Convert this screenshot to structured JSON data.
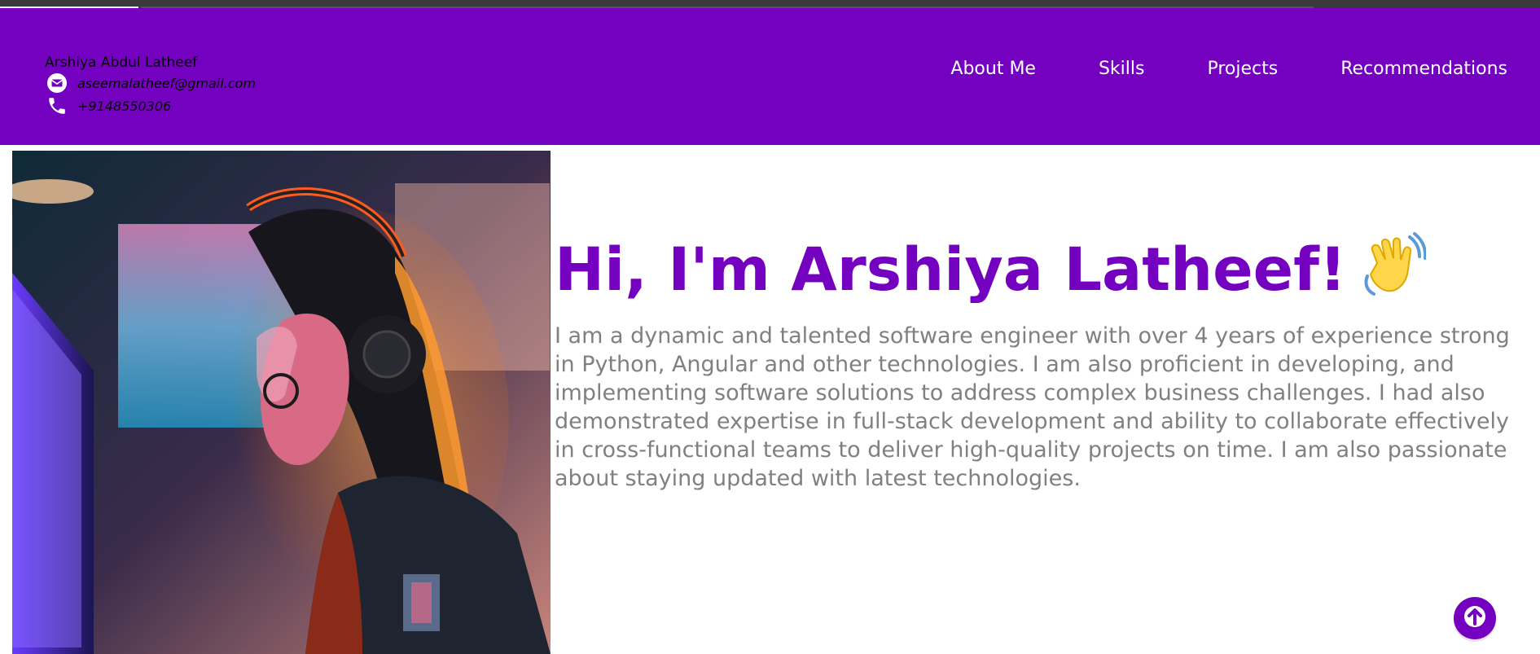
{
  "header": {
    "name": "Arshiya Abdul Latheef",
    "email": "aseemalatheef@gmail.com",
    "phone": "+9148550306",
    "icons": {
      "email": "envelope-icon",
      "phone": "phone-icon"
    }
  },
  "nav": {
    "items": [
      {
        "label": "About Me"
      },
      {
        "label": "Skills"
      },
      {
        "label": "Projects"
      },
      {
        "label": "Recommendations"
      }
    ]
  },
  "hero": {
    "title": "Hi, I'm Arshiya Latheef!",
    "emoji": "waving-hand-icon",
    "bio": "I am a dynamic and talented software engineer with over 4 years of experience strong in Python, Angular and other technologies. I am also proficient in developing, and implementing software solutions to address complex business challenges. I had also demonstrated expertise in full-stack development and ability to collaborate effectively in cross-functional teams to deliver high-quality projects on time. I am also passionate about staying updated with latest technologies."
  },
  "scroll_top": {
    "icon": "arrow-up-icon"
  },
  "colors": {
    "accent": "#7400c0",
    "bio_text": "#808080",
    "nav_text": "#ffffff"
  }
}
